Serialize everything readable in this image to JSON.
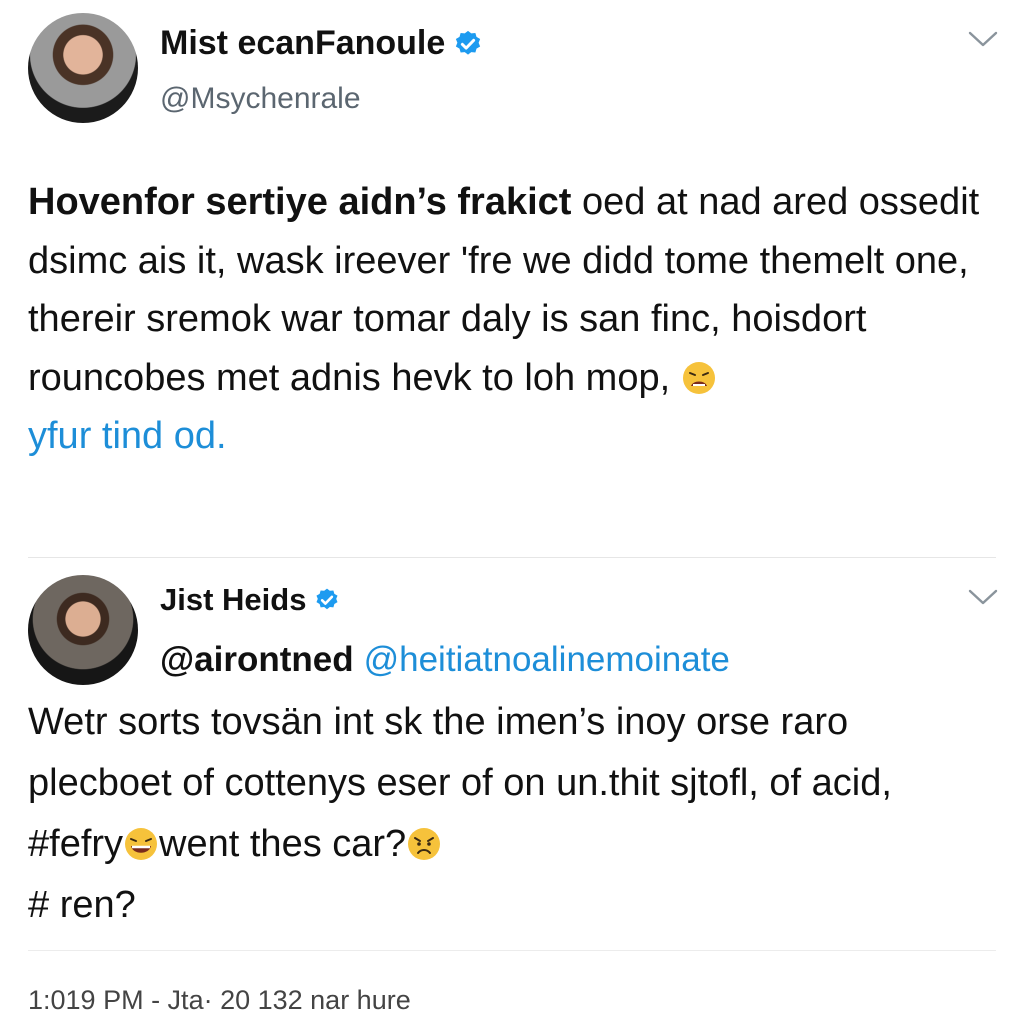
{
  "tweets": [
    {
      "display_name": "Mist ecanFanoule",
      "handle": "@Msychenrale",
      "verified": true,
      "avatar_icon": "avatar-photo",
      "menu_icon": "chevron-down-icon",
      "body": {
        "lead": "Hovenfor sertiye aidn’s frakict",
        "text": " oed at nad ared ossedit dsimc ais it, wask ireever 'fre we didd tome themelt one, thereir sremok war tomar daly is san finc, hoisdort rouncobes met adnis hevk to loh mop, ",
        "emoji": "tired-face-emoji",
        "link": "yfur tind od."
      }
    },
    {
      "display_name": "Jist Heids",
      "verified": true,
      "avatar_icon": "avatar-photo",
      "menu_icon": "chevron-down-icon",
      "mention_primary": "@airontned",
      "mention_secondary": "@heitiatnoalinemoinate",
      "body": {
        "part1": "Wetr sorts tovsän int sk the imen’s inoy orse raro plecboet of cottenys eser of on un.thit sjtofl, of acid, #fefry",
        "emoji1": "grinning-sweat-emoji",
        "part2": "went thes car?",
        "emoji2": "worried-face-emoji",
        "part3": "# ren?"
      },
      "timestamp": "1:019 PM  - Jta· 20 132 nar hure"
    }
  ],
  "colors": {
    "link": "#1d8ed8",
    "verified": "#1d9bf0",
    "muted": "#5b6670",
    "emoji": "#f6c23b"
  }
}
